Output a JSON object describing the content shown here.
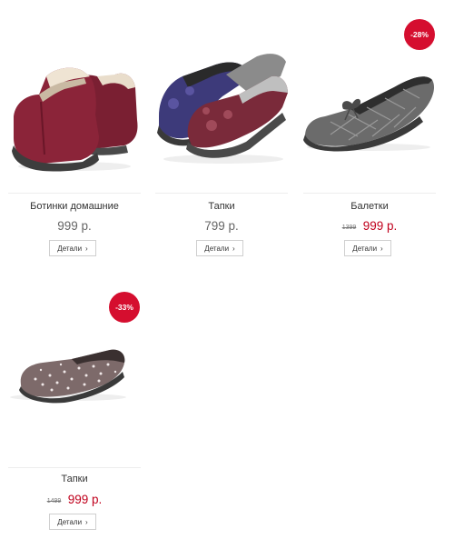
{
  "products": [
    {
      "name": "Ботинки домашние",
      "price": "999 р.",
      "details_label": "Детали"
    },
    {
      "name": "Тапки",
      "price": "799 р.",
      "details_label": "Детали"
    },
    {
      "name": "Балетки",
      "old_price": "1399",
      "price": "999 р.",
      "discount": "-28%",
      "details_label": "Детали"
    },
    {
      "name": "Тапки",
      "old_price": "1499",
      "price": "999 р.",
      "discount": "-33%",
      "details_label": "Детали"
    }
  ],
  "colors": {
    "sale_price": "#c0001c",
    "badge": "#d50e2f",
    "regular_price": "#666666"
  }
}
